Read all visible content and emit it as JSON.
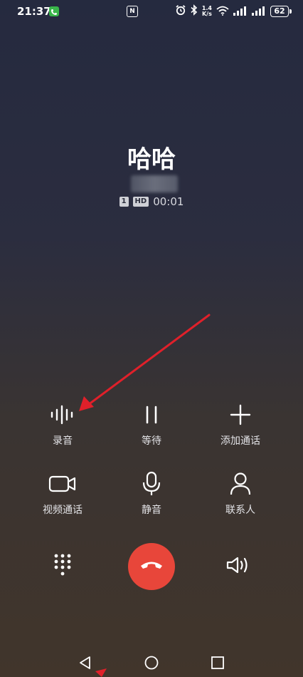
{
  "status_bar": {
    "time": "21:37",
    "nfc_label": "N",
    "net_speed_value": "1.4",
    "net_speed_unit": "K/s",
    "battery_level": "62"
  },
  "caller": {
    "name": "哈哈",
    "sim_tag": "1",
    "hd_tag": "HD",
    "duration": "00:01"
  },
  "controls": {
    "record": "录音",
    "hold": "等待",
    "add_call": "添加通话",
    "video_call": "视频通话",
    "mute": "静音",
    "contacts": "联系人"
  },
  "colors": {
    "end_call": "#e8463a",
    "annotation_arrow": "#e0202a",
    "call_indicator": "#39b54a"
  },
  "icons": [
    "phone-icon",
    "nfc-icon",
    "alarm-icon",
    "bluetooth-icon",
    "wifi-icon",
    "signal-icon",
    "battery-icon",
    "waveform-icon",
    "pause-icon",
    "plus-icon",
    "video-camera-icon",
    "microphone-icon",
    "person-icon",
    "dialpad-icon",
    "end-call-icon",
    "speaker-icon",
    "back-icon",
    "home-icon",
    "recents-icon"
  ]
}
